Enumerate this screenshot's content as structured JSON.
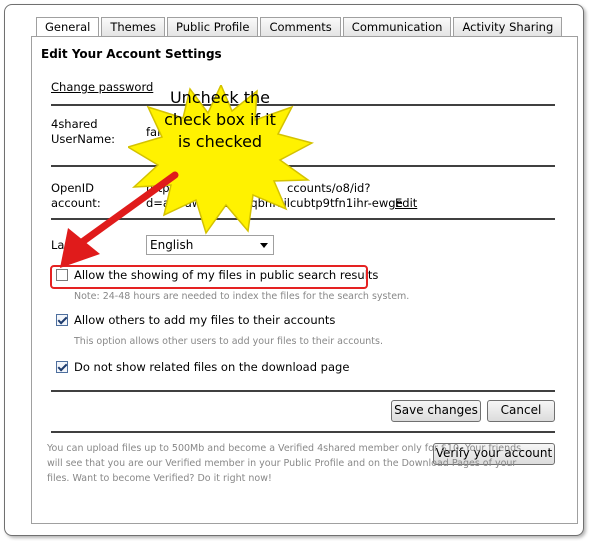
{
  "tabs": [
    "General",
    "Themes",
    "Public Profile",
    "Comments",
    "Communication",
    "Activity Sharing"
  ],
  "heading": "Edit Your Account Settings",
  "change_password": "Change password",
  "username": {
    "label_line1": "4shared",
    "label_line2": "UserName:",
    "value": "falle"
  },
  "openid": {
    "label_line1": "OpenID",
    "label_line2": "account:",
    "value_line1": "http",
    "value_line1_end": "ccounts/o8/id?",
    "value_line2_start": "d=aitoawmiwx",
    "value_line2_end": "cqbhf7ilcubtp9tfn1ihr-ewge",
    "edit_link": "Edit"
  },
  "language": {
    "label": "Langu",
    "selected": "English"
  },
  "options": [
    {
      "label": "Allow the showing of my files in public search results",
      "checked": false,
      "note": "Note: 24-48 hours are needed to index the files for the search system."
    },
    {
      "label": "Allow others to add my files to their accounts",
      "checked": true,
      "note": "This option allows other users to add your files to their accounts."
    },
    {
      "label": "Do not show related files on the download page",
      "checked": true,
      "note": ""
    }
  ],
  "buttons": {
    "save": "Save changes",
    "cancel": "Cancel",
    "verify": "Verify your account"
  },
  "footer_text": "You can upload files up to 500Mb and become a Verified 4shared member only for $10. Your friends will see that you are our Verified member in your Public Profile and on the Download Pages of your files. Want to become Verified? Do it right now!",
  "callout": {
    "line1": "Uncheck the",
    "line2": "check box if it",
    "line3": "is checked",
    "fill": "#fff200",
    "stroke": "#d4c200",
    "arrow_color": "#e01b1b"
  }
}
